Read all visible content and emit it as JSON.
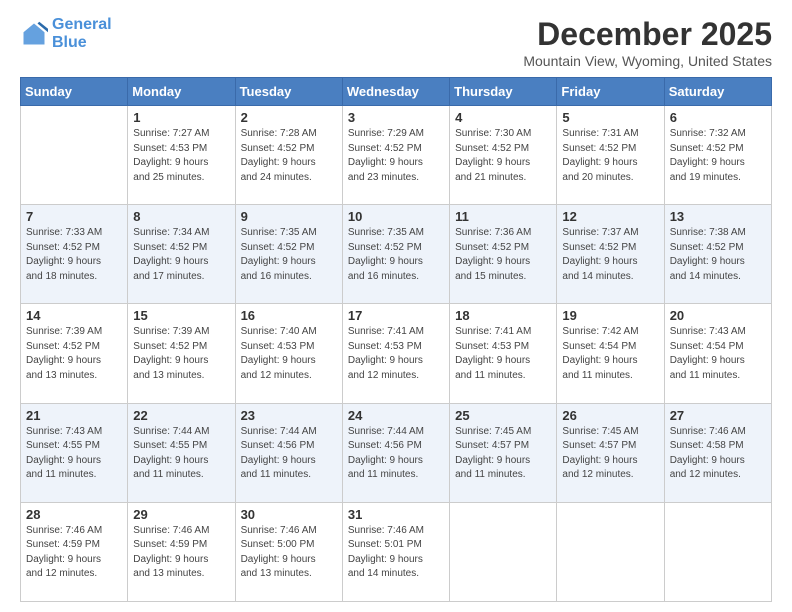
{
  "logo": {
    "line1": "General",
    "line2": "Blue"
  },
  "header": {
    "month": "December 2025",
    "location": "Mountain View, Wyoming, United States"
  },
  "days_of_week": [
    "Sunday",
    "Monday",
    "Tuesday",
    "Wednesday",
    "Thursday",
    "Friday",
    "Saturday"
  ],
  "weeks": [
    [
      {
        "day": "",
        "info": ""
      },
      {
        "day": "1",
        "info": "Sunrise: 7:27 AM\nSunset: 4:53 PM\nDaylight: 9 hours\nand 25 minutes."
      },
      {
        "day": "2",
        "info": "Sunrise: 7:28 AM\nSunset: 4:52 PM\nDaylight: 9 hours\nand 24 minutes."
      },
      {
        "day": "3",
        "info": "Sunrise: 7:29 AM\nSunset: 4:52 PM\nDaylight: 9 hours\nand 23 minutes."
      },
      {
        "day": "4",
        "info": "Sunrise: 7:30 AM\nSunset: 4:52 PM\nDaylight: 9 hours\nand 21 minutes."
      },
      {
        "day": "5",
        "info": "Sunrise: 7:31 AM\nSunset: 4:52 PM\nDaylight: 9 hours\nand 20 minutes."
      },
      {
        "day": "6",
        "info": "Sunrise: 7:32 AM\nSunset: 4:52 PM\nDaylight: 9 hours\nand 19 minutes."
      }
    ],
    [
      {
        "day": "7",
        "info": "Sunrise: 7:33 AM\nSunset: 4:52 PM\nDaylight: 9 hours\nand 18 minutes."
      },
      {
        "day": "8",
        "info": "Sunrise: 7:34 AM\nSunset: 4:52 PM\nDaylight: 9 hours\nand 17 minutes."
      },
      {
        "day": "9",
        "info": "Sunrise: 7:35 AM\nSunset: 4:52 PM\nDaylight: 9 hours\nand 16 minutes."
      },
      {
        "day": "10",
        "info": "Sunrise: 7:35 AM\nSunset: 4:52 PM\nDaylight: 9 hours\nand 16 minutes."
      },
      {
        "day": "11",
        "info": "Sunrise: 7:36 AM\nSunset: 4:52 PM\nDaylight: 9 hours\nand 15 minutes."
      },
      {
        "day": "12",
        "info": "Sunrise: 7:37 AM\nSunset: 4:52 PM\nDaylight: 9 hours\nand 14 minutes."
      },
      {
        "day": "13",
        "info": "Sunrise: 7:38 AM\nSunset: 4:52 PM\nDaylight: 9 hours\nand 14 minutes."
      }
    ],
    [
      {
        "day": "14",
        "info": "Sunrise: 7:39 AM\nSunset: 4:52 PM\nDaylight: 9 hours\nand 13 minutes."
      },
      {
        "day": "15",
        "info": "Sunrise: 7:39 AM\nSunset: 4:52 PM\nDaylight: 9 hours\nand 13 minutes."
      },
      {
        "day": "16",
        "info": "Sunrise: 7:40 AM\nSunset: 4:53 PM\nDaylight: 9 hours\nand 12 minutes."
      },
      {
        "day": "17",
        "info": "Sunrise: 7:41 AM\nSunset: 4:53 PM\nDaylight: 9 hours\nand 12 minutes."
      },
      {
        "day": "18",
        "info": "Sunrise: 7:41 AM\nSunset: 4:53 PM\nDaylight: 9 hours\nand 11 minutes."
      },
      {
        "day": "19",
        "info": "Sunrise: 7:42 AM\nSunset: 4:54 PM\nDaylight: 9 hours\nand 11 minutes."
      },
      {
        "day": "20",
        "info": "Sunrise: 7:43 AM\nSunset: 4:54 PM\nDaylight: 9 hours\nand 11 minutes."
      }
    ],
    [
      {
        "day": "21",
        "info": "Sunrise: 7:43 AM\nSunset: 4:55 PM\nDaylight: 9 hours\nand 11 minutes."
      },
      {
        "day": "22",
        "info": "Sunrise: 7:44 AM\nSunset: 4:55 PM\nDaylight: 9 hours\nand 11 minutes."
      },
      {
        "day": "23",
        "info": "Sunrise: 7:44 AM\nSunset: 4:56 PM\nDaylight: 9 hours\nand 11 minutes."
      },
      {
        "day": "24",
        "info": "Sunrise: 7:44 AM\nSunset: 4:56 PM\nDaylight: 9 hours\nand 11 minutes."
      },
      {
        "day": "25",
        "info": "Sunrise: 7:45 AM\nSunset: 4:57 PM\nDaylight: 9 hours\nand 11 minutes."
      },
      {
        "day": "26",
        "info": "Sunrise: 7:45 AM\nSunset: 4:57 PM\nDaylight: 9 hours\nand 12 minutes."
      },
      {
        "day": "27",
        "info": "Sunrise: 7:46 AM\nSunset: 4:58 PM\nDaylight: 9 hours\nand 12 minutes."
      }
    ],
    [
      {
        "day": "28",
        "info": "Sunrise: 7:46 AM\nSunset: 4:59 PM\nDaylight: 9 hours\nand 12 minutes."
      },
      {
        "day": "29",
        "info": "Sunrise: 7:46 AM\nSunset: 4:59 PM\nDaylight: 9 hours\nand 13 minutes."
      },
      {
        "day": "30",
        "info": "Sunrise: 7:46 AM\nSunset: 5:00 PM\nDaylight: 9 hours\nand 13 minutes."
      },
      {
        "day": "31",
        "info": "Sunrise: 7:46 AM\nSunset: 5:01 PM\nDaylight: 9 hours\nand 14 minutes."
      },
      {
        "day": "",
        "info": ""
      },
      {
        "day": "",
        "info": ""
      },
      {
        "day": "",
        "info": ""
      }
    ]
  ]
}
